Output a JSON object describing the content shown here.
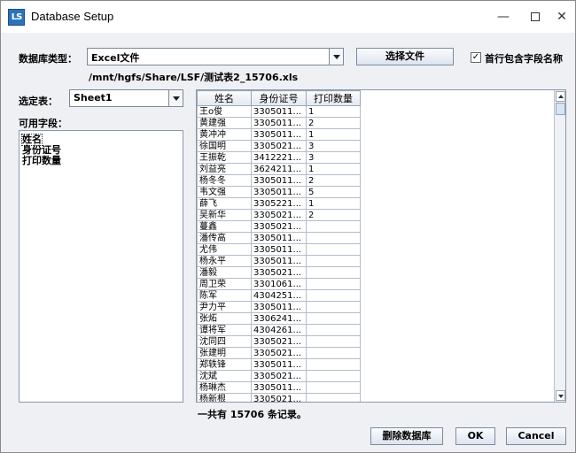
{
  "window": {
    "title": "Database Setup",
    "app_icon": "LS",
    "minimize": "—",
    "close": "✕"
  },
  "db_type": {
    "label": "数据库类型：",
    "selected": "Excel文件"
  },
  "choose_file_label": "选择文件",
  "first_row_header": {
    "label": "首行包含字段名称",
    "checked": "✓"
  },
  "file_path": "/mnt/hgfs/Share/LSF/测试表2_15706.xls",
  "sheet": {
    "label": "选定表：",
    "selected": "Sheet1"
  },
  "fields": {
    "label": "可用字段：",
    "items": [
      "姓名",
      "身份证号",
      "打印数量"
    ]
  },
  "table": {
    "headers": [
      "姓名",
      "身份证号",
      "打印数量"
    ],
    "rows": [
      [
        "王o俊",
        "3305011...",
        "1"
      ],
      [
        "黄建强",
        "3305011...",
        "2"
      ],
      [
        "黄冲冲",
        "3305011...",
        "1"
      ],
      [
        "徐国明",
        "3305021...",
        "3"
      ],
      [
        "王振乾",
        "3412221...",
        "3"
      ],
      [
        "刘益亮",
        "3624211...",
        "1"
      ],
      [
        "杨冬冬",
        "3305011...",
        "2"
      ],
      [
        "韦文强",
        "3305011...",
        "5"
      ],
      [
        "薛飞",
        "3305221...",
        "1"
      ],
      [
        "吴新华",
        "3305021...",
        "2"
      ],
      [
        "蔓鑫",
        "3305021...",
        ""
      ],
      [
        "潘传高",
        "3305011...",
        ""
      ],
      [
        "尤伟",
        "3305011...",
        ""
      ],
      [
        "杨永平",
        "3305011...",
        ""
      ],
      [
        "潘毅",
        "3305021...",
        ""
      ],
      [
        "周卫荣",
        "3301061...",
        ""
      ],
      [
        "陈军",
        "4304251...",
        ""
      ],
      [
        "尹力平",
        "3305011...",
        ""
      ],
      [
        "张炻",
        "3306241...",
        ""
      ],
      [
        "谭将军",
        "4304261...",
        ""
      ],
      [
        "沈同四",
        "3305021...",
        ""
      ],
      [
        "张建明",
        "3305021...",
        ""
      ],
      [
        "郑轶锋",
        "3305011...",
        ""
      ],
      [
        "沈斌",
        "3305021...",
        ""
      ],
      [
        "杨琳杰",
        "3305011...",
        ""
      ],
      [
        "杨新根",
        "3305021...",
        ""
      ]
    ]
  },
  "record_count": "一共有 15706 条记录。",
  "buttons": {
    "delete_db": "删除数据库",
    "ok": "OK",
    "cancel": "Cancel"
  }
}
